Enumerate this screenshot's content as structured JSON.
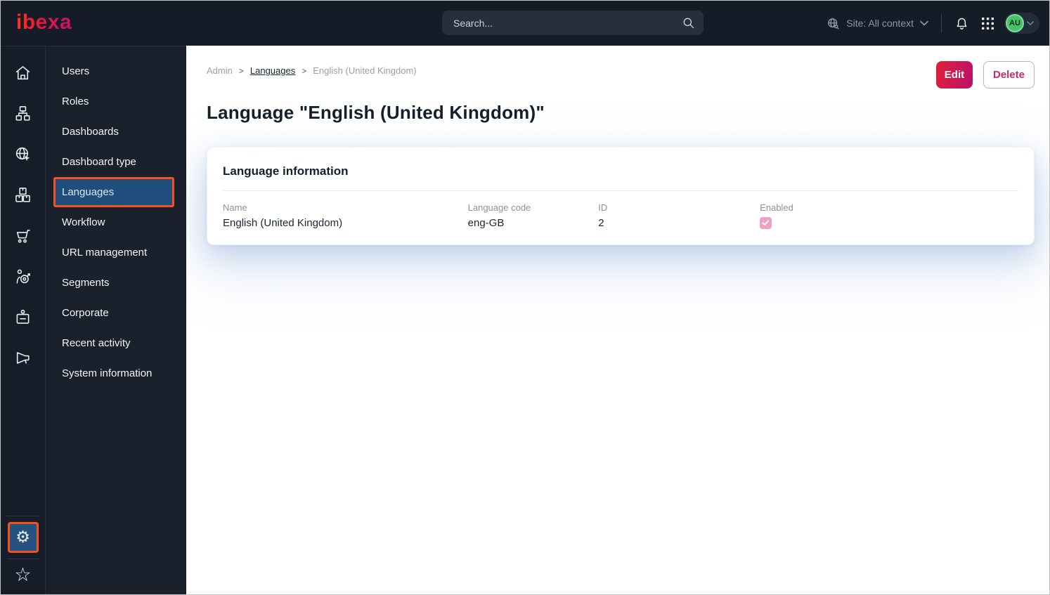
{
  "topbar": {
    "logo_text": "ibexa",
    "search": {
      "placeholder": "Search..."
    },
    "site_context_label": "Site: All context",
    "avatar_initials": "AU"
  },
  "rail": {
    "icons": [
      "home",
      "content-structure",
      "site-web",
      "products",
      "commerce",
      "personalization",
      "corporate",
      "marketing"
    ],
    "bottom_icons": [
      "settings",
      "bookmarks"
    ],
    "active_icon": "settings",
    "settings_glyph": "⚙",
    "bookmarks_glyph": "☆"
  },
  "sidebar": {
    "items": [
      {
        "label": "Users"
      },
      {
        "label": "Roles"
      },
      {
        "label": "Dashboards"
      },
      {
        "label": "Dashboard type"
      },
      {
        "label": "Languages",
        "selected": true,
        "highlighted": true
      },
      {
        "label": "Workflow"
      },
      {
        "label": "URL management"
      },
      {
        "label": "Segments"
      },
      {
        "label": "Corporate"
      },
      {
        "label": "Recent activity"
      },
      {
        "label": "System information"
      }
    ]
  },
  "breadcrumb": {
    "separator": ">",
    "items": [
      {
        "label": "Admin",
        "type": "muted"
      },
      {
        "label": "Languages",
        "type": "link"
      },
      {
        "label": "English (United Kingdom)",
        "type": "muted"
      }
    ]
  },
  "actions": {
    "edit_label": "Edit",
    "delete_label": "Delete"
  },
  "page": {
    "title": "Language \"English (United Kingdom)\""
  },
  "card": {
    "title": "Language information",
    "fields": [
      {
        "label": "Name",
        "value": "English (United Kingdom)"
      },
      {
        "label": "Language code",
        "value": "eng-GB"
      },
      {
        "label": "ID",
        "value": "2"
      },
      {
        "label": "Enabled",
        "checked": true
      }
    ]
  },
  "colors": {
    "topbar_bg": "#151c27",
    "sidebar_bg": "#1a212d",
    "selected_item_bg": "#1f4d7c",
    "annotation_orange": "#f4511e",
    "primary_pink": "#d0135c",
    "edit_gradient_start": "#de2238",
    "edit_gradient_end": "#bb0f69",
    "checkbox_pink": "#eaa3c5",
    "avatar_green": "#4abf6b"
  }
}
